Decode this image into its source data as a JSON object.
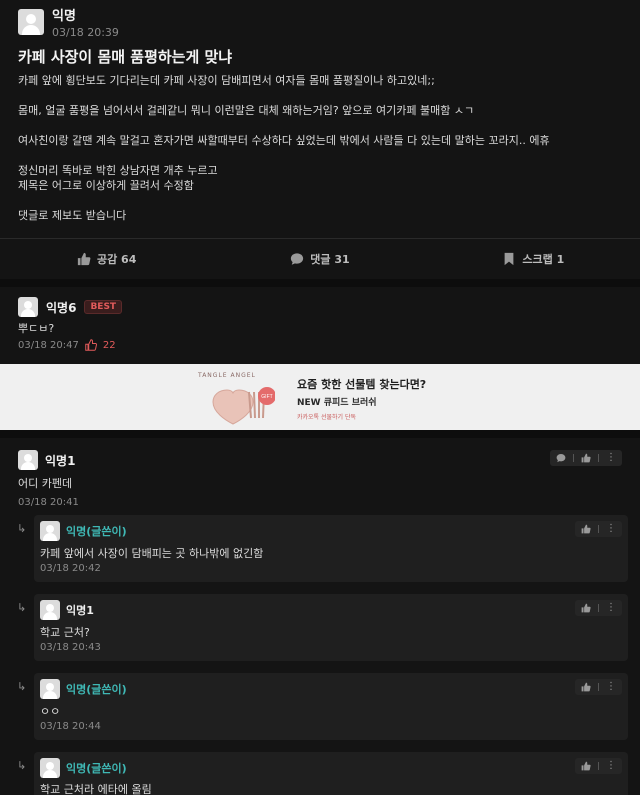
{
  "post": {
    "author": "익명",
    "time": "03/18 20:39",
    "title": "카페 사장이 몸매 품평하는게 맞냐",
    "paragraphs": [
      "카페 앞에 횡단보도 기다리는데 카페 사장이 담배피면서 여자들 몸매 품평질이나 하고있네;;",
      "몸매, 얼굴 품평을 넘어서서 걸레같니 뭐니 이런말은 대체 왜하는거임? 앞으로 여기카페 불매함 ㅅㄱ",
      "여사친이랑 갈땐 계속 말걸고 혼자가면 싸할때부터 수상하다 싶었는데 밖에서 사람들 다 있는데 말하는 꼬라지.. 에휴",
      "정신머리 똑바로 박힌 상남자면 개추 누르고\n제목은 어그로 이상하게 끌려서 수정함",
      "댓글로 제보도 받습니다"
    ],
    "actions": {
      "like": "공감 64",
      "comment": "댓글 31",
      "scrap": "스크랩 1"
    }
  },
  "best_comment": {
    "author": "익명6",
    "badge": "BEST",
    "text": "뿌ㄷㅂ?",
    "time": "03/18 20:47",
    "likes": "22"
  },
  "ad": {
    "brand": "TANGLE ANGEL",
    "badge": "GIFT",
    "title": "요즘 핫한 선물템 찾는다면?",
    "subtitle": "NEW 큐피드 브러쉬",
    "link": "카카오톡 선물하기 단독"
  },
  "comments": [
    {
      "author": "익명1",
      "text": "어디 카펜데",
      "time": "03/18 20:41"
    }
  ],
  "replies": [
    {
      "author": "익명(글쓴이)",
      "is_op": true,
      "text": "카페 앞에서 사장이 담배피는 곳 하나밖에 없긴함",
      "time": "03/18 20:42"
    },
    {
      "author": "익명1",
      "is_op": false,
      "text": "학교 근처?",
      "time": "03/18 20:43"
    },
    {
      "author": "익명(글쓴이)",
      "is_op": true,
      "text": "ㅇㅇ",
      "time": "03/18 20:44"
    },
    {
      "author": "익명(글쓴이)",
      "is_op": true,
      "text": "학교 근처라 에타에 올림",
      "time": ""
    }
  ],
  "colors": {
    "background": "#141414",
    "op_name": "#3fb8b5",
    "best": "#e25b5b"
  }
}
